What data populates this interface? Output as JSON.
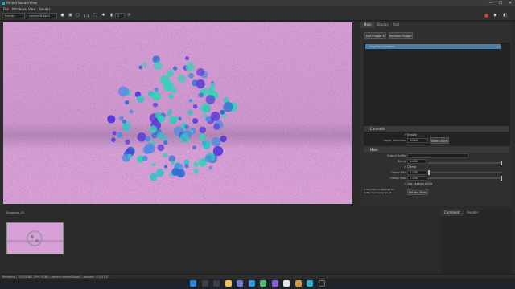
{
  "window": {
    "title": "Arnold RenderView",
    "minimize_glyph": "—",
    "maximize_glyph": "☐",
    "close_glyph": "✕"
  },
  "menu": [
    "File",
    "Windows",
    "View",
    "Render"
  ],
  "toolbar": {
    "renderer_select": "Beauty",
    "camera_select": "cameraShape1",
    "ratio_label": "1:1",
    "number_field": "0"
  },
  "viewport": {
    "background_color": "#d8a0d6",
    "sphere_colors": [
      "#2fc4c4",
      "#2d6fd6",
      "#5a3bd8",
      "#38d0b8",
      "#4d8ce0"
    ]
  },
  "right_panel": {
    "tabs": [
      "Main",
      "Display",
      "Post"
    ],
    "add_imager_button": "Add Imager ▾",
    "remove_imager_button": "Remove Imager",
    "selected_imager": "imagerDenoiserOidn1",
    "common_section": "Common",
    "enable_label": "Enable",
    "layer_selection_label": "Layer Selection",
    "layer_selection_value": "RGBA",
    "select_aovs_button": "Select AOVs",
    "main_section": "Main",
    "output_suffix_label": "Output Suffix",
    "output_suffix_value": "",
    "blend_label": "Blend",
    "blend_value": "1.000",
    "blend_level": 1.0,
    "clamp_label": "Clamp",
    "clamp_min_label": "Clamp Min",
    "clamp_min_value": "0.000",
    "clamp_min_level": 0.0,
    "clamp_max_label": "Clamp Max",
    "clamp_max_value": "1.000",
    "clamp_max_level": 1.0,
    "use_feature_aovs_label": "Use Feature AOVs",
    "info_text_line1": "A live filter is required for",
    "info_text_line2": "better denoising result.",
    "set_filter_button": "Set the Filter"
  },
  "bottom": {
    "snapshot_name": "Snapshot_01",
    "comment_tab": "Comment",
    "render_tab": "Render"
  },
  "status": {
    "text": "Rendering  |  1920/1080 (29%) RGBA  |  camera cameraShape1  |  samples: 4/1/1/1/1/1"
  },
  "colors": {
    "accent_blue": "#4b7fa8",
    "recording_red": "#d23b3b"
  }
}
